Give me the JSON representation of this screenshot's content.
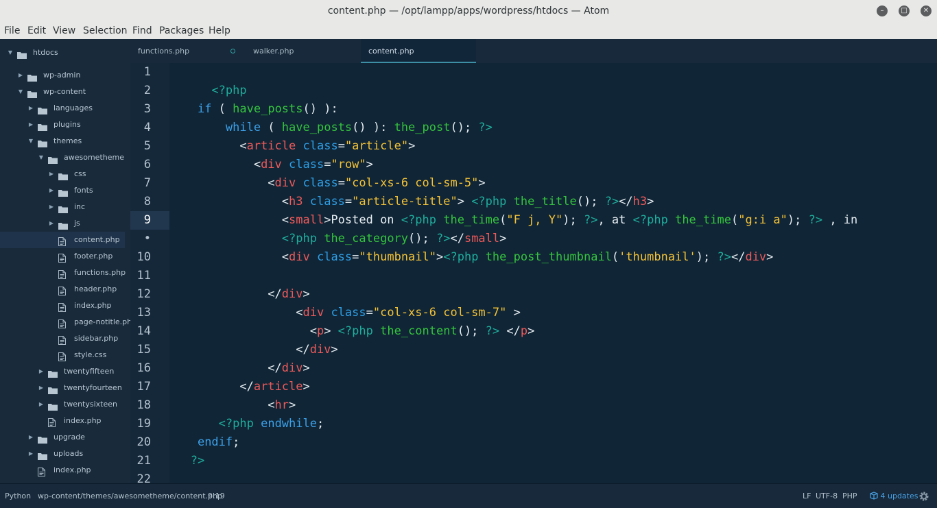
{
  "window": {
    "title": "content.php — /opt/lampp/apps/wordpress/htdocs — Atom"
  },
  "menu": [
    "File",
    "Edit",
    "View",
    "Selection",
    "Find",
    "Packages",
    "Help"
  ],
  "tree": [
    {
      "label": "htdocs",
      "type": "folder",
      "expanded": true
    },
    {
      "label": "wp-admin",
      "type": "folder",
      "expanded": false
    },
    {
      "label": "wp-content",
      "type": "folder",
      "expanded": true
    },
    {
      "label": "languages",
      "type": "folder",
      "expanded": false
    },
    {
      "label": "plugins",
      "type": "folder",
      "expanded": false
    },
    {
      "label": "themes",
      "type": "folder",
      "expanded": true
    },
    {
      "label": "awesometheme",
      "type": "folder",
      "expanded": true
    },
    {
      "label": "css",
      "type": "folder",
      "expanded": false
    },
    {
      "label": "fonts",
      "type": "folder",
      "expanded": false
    },
    {
      "label": "inc",
      "type": "folder",
      "expanded": false
    },
    {
      "label": "js",
      "type": "folder",
      "expanded": false
    },
    {
      "label": "content.php",
      "type": "file",
      "selected": true
    },
    {
      "label": "footer.php",
      "type": "file"
    },
    {
      "label": "functions.php",
      "type": "file"
    },
    {
      "label": "header.php",
      "type": "file"
    },
    {
      "label": "index.php",
      "type": "file"
    },
    {
      "label": "page-notitle.php",
      "type": "file"
    },
    {
      "label": "sidebar.php",
      "type": "file"
    },
    {
      "label": "style.css",
      "type": "file"
    },
    {
      "label": "twentyfifteen",
      "type": "folder",
      "expanded": false
    },
    {
      "label": "twentyfourteen",
      "type": "folder",
      "expanded": false
    },
    {
      "label": "twentysixteen",
      "type": "folder",
      "expanded": false
    },
    {
      "label": "index.php",
      "type": "file"
    },
    {
      "label": "upgrade",
      "type": "folder",
      "expanded": false
    },
    {
      "label": "uploads",
      "type": "folder",
      "expanded": false
    },
    {
      "label": "index.php",
      "type": "file"
    }
  ],
  "tabs": [
    {
      "label": "functions.php",
      "modified": true,
      "active": false
    },
    {
      "label": "walker.php",
      "modified": false,
      "active": false
    },
    {
      "label": "content.php",
      "modified": false,
      "active": true
    }
  ],
  "gutter": [
    "1",
    "2",
    "3",
    "4",
    "5",
    "6",
    "7",
    "8",
    "9",
    "•",
    "10",
    "11",
    "12",
    "13",
    "14",
    "15",
    "16",
    "17",
    "18",
    "19",
    "20",
    "21",
    "22"
  ],
  "current_line": "9",
  "code": [
    [],
    [
      [
        "      ",
        ""
      ],
      [
        "<?php",
        "php"
      ]
    ],
    [
      [
        "    ",
        ""
      ],
      [
        "if",
        "kw"
      ],
      [
        " ( ",
        ""
      ],
      [
        "have_posts",
        "fn"
      ],
      [
        "() ):",
        ""
      ]
    ],
    [
      [
        "        ",
        ""
      ],
      [
        "while",
        "kw"
      ],
      [
        " ( ",
        ""
      ],
      [
        "have_posts",
        "fn"
      ],
      [
        "() ): ",
        ""
      ],
      [
        "the_post",
        "fn"
      ],
      [
        "(); ",
        ""
      ],
      [
        "?>",
        "php"
      ]
    ],
    [
      [
        "          <",
        ""
      ],
      [
        "article",
        "tag"
      ],
      [
        " ",
        ""
      ],
      [
        "class",
        "attr"
      ],
      [
        "=",
        ""
      ],
      [
        "\"article\"",
        "str"
      ],
      [
        ">",
        ""
      ]
    ],
    [
      [
        "            <",
        ""
      ],
      [
        "div",
        "tag"
      ],
      [
        " ",
        ""
      ],
      [
        "class",
        "attr"
      ],
      [
        "=",
        ""
      ],
      [
        "\"row\"",
        "str"
      ],
      [
        ">",
        ""
      ]
    ],
    [
      [
        "              <",
        ""
      ],
      [
        "div",
        "tag"
      ],
      [
        " ",
        ""
      ],
      [
        "class",
        "attr"
      ],
      [
        "=",
        ""
      ],
      [
        "\"col-xs-6 col-sm-5\"",
        "str"
      ],
      [
        ">",
        ""
      ]
    ],
    [
      [
        "                <",
        ""
      ],
      [
        "h3",
        "tag"
      ],
      [
        " ",
        ""
      ],
      [
        "class",
        "attr"
      ],
      [
        "=",
        ""
      ],
      [
        "\"article-title\"",
        "str"
      ],
      [
        "> ",
        ""
      ],
      [
        "<?php",
        "php"
      ],
      [
        " ",
        ""
      ],
      [
        "the_title",
        "fn"
      ],
      [
        "(); ",
        ""
      ],
      [
        "?>",
        "php"
      ],
      [
        "</",
        ""
      ],
      [
        "h3",
        "tag"
      ],
      [
        ">",
        ""
      ]
    ],
    [
      [
        "                <",
        ""
      ],
      [
        "small",
        "tag"
      ],
      [
        ">Posted on ",
        ""
      ],
      [
        "<?php",
        "php"
      ],
      [
        " ",
        ""
      ],
      [
        "the_time",
        "fn"
      ],
      [
        "(",
        ""
      ],
      [
        "\"F j, Y\"",
        "str"
      ],
      [
        "); ",
        ""
      ],
      [
        "?>",
        "php"
      ],
      [
        ", at ",
        ""
      ],
      [
        "<?php",
        "php"
      ],
      [
        " ",
        ""
      ],
      [
        "the_time",
        "fn"
      ],
      [
        "(",
        ""
      ],
      [
        "\"g:i a\"",
        "str"
      ],
      [
        "); ",
        ""
      ],
      [
        "?>",
        "php"
      ],
      [
        " , in",
        ""
      ]
    ],
    [
      [
        "                ",
        ""
      ],
      [
        "<?php",
        "php"
      ],
      [
        " ",
        ""
      ],
      [
        "the_category",
        "fn"
      ],
      [
        "(); ",
        ""
      ],
      [
        "?>",
        "php"
      ],
      [
        "</",
        ""
      ],
      [
        "small",
        "tag"
      ],
      [
        ">",
        ""
      ]
    ],
    [
      [
        "                <",
        ""
      ],
      [
        "div",
        "tag"
      ],
      [
        " ",
        ""
      ],
      [
        "class",
        "attr"
      ],
      [
        "=",
        ""
      ],
      [
        "\"thumbnail\"",
        "str"
      ],
      [
        ">",
        ""
      ],
      [
        "<?php",
        "php"
      ],
      [
        " ",
        ""
      ],
      [
        "the_post_thumbnail",
        "fn"
      ],
      [
        "(",
        ""
      ],
      [
        "'thumbnail'",
        "str"
      ],
      [
        "); ",
        ""
      ],
      [
        "?>",
        "php"
      ],
      [
        "</",
        ""
      ],
      [
        "div",
        "tag"
      ],
      [
        ">",
        ""
      ]
    ],
    [],
    [
      [
        "              </",
        ""
      ],
      [
        "div",
        "tag"
      ],
      [
        ">",
        ""
      ]
    ],
    [
      [
        "                  <",
        ""
      ],
      [
        "div",
        "tag"
      ],
      [
        " ",
        ""
      ],
      [
        "class",
        "attr"
      ],
      [
        "=",
        ""
      ],
      [
        "\"col-xs-6 col-sm-7\"",
        "str"
      ],
      [
        " >",
        ""
      ]
    ],
    [
      [
        "                    <",
        ""
      ],
      [
        "p",
        "tag"
      ],
      [
        "> ",
        ""
      ],
      [
        "<?php",
        "php"
      ],
      [
        " ",
        ""
      ],
      [
        "the_content",
        "fn"
      ],
      [
        "(); ",
        ""
      ],
      [
        "?>",
        "php"
      ],
      [
        " </",
        ""
      ],
      [
        "p",
        "tag"
      ],
      [
        ">",
        ""
      ]
    ],
    [
      [
        "                  </",
        ""
      ],
      [
        "div",
        "tag"
      ],
      [
        ">",
        ""
      ]
    ],
    [
      [
        "              </",
        ""
      ],
      [
        "div",
        "tag"
      ],
      [
        ">",
        ""
      ]
    ],
    [
      [
        "          </",
        ""
      ],
      [
        "article",
        "tag"
      ],
      [
        ">",
        ""
      ]
    ],
    [
      [
        "              <",
        ""
      ],
      [
        "hr",
        "tag"
      ],
      [
        ">",
        ""
      ]
    ],
    [
      [
        "       ",
        ""
      ],
      [
        "<?php",
        "php"
      ],
      [
        " ",
        ""
      ],
      [
        "endwhile",
        "kw"
      ],
      [
        ";",
        ""
      ]
    ],
    [
      [
        "    ",
        ""
      ],
      [
        "endif",
        "kw"
      ],
      [
        ";",
        ""
      ]
    ],
    [
      [
        "   ",
        ""
      ],
      [
        "?>",
        "php"
      ]
    ],
    []
  ],
  "status": {
    "grammar": "Python",
    "path": "wp-content/themes/awesometheme/content.php",
    "cursor": "9:19",
    "line_ending": "LF",
    "encoding": "UTF-8",
    "language": "PHP",
    "updates": "4 updates"
  }
}
